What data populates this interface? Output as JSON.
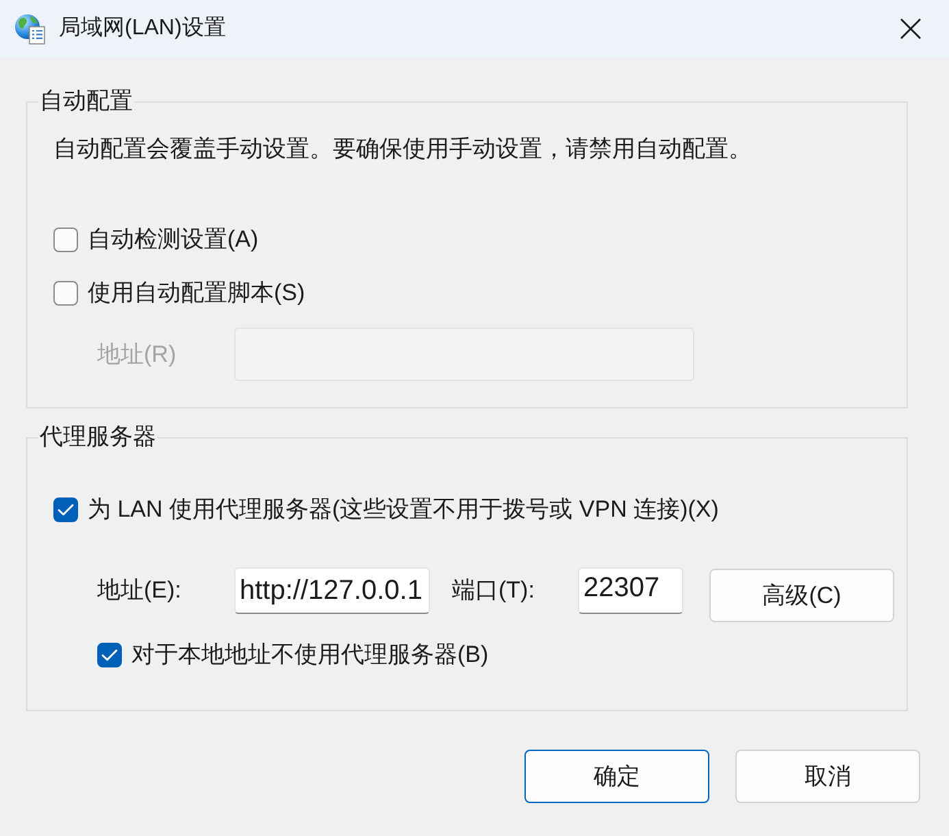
{
  "window": {
    "title": "局域网(LAN)设置"
  },
  "auto_config": {
    "legend": "自动配置",
    "description": "自动配置会覆盖手动设置。要确保使用手动设置，请禁用自动配置。",
    "options": [
      {
        "label": "自动检测设置(A)",
        "checked": false
      },
      {
        "label": "使用自动配置脚本(S)",
        "checked": false
      }
    ],
    "script_address": {
      "label": "地址(R)",
      "disabled": true
    }
  },
  "proxy_server": {
    "legend": "代理服务器",
    "use_proxy": {
      "label": "为 LAN 使用代理服务器(这些设置不用于拨号或 VPN 连接)(X)",
      "checked": true
    },
    "address": {
      "label": "地址(E):",
      "value": "http://127.0.0.1"
    },
    "port": {
      "label": "端口(T):",
      "value": "22307"
    },
    "advanced_button": {
      "label": "高级(C)"
    },
    "bypass_local": {
      "label": "对于本地地址不使用代理服务器(B)",
      "checked": true
    }
  },
  "buttons": [
    {
      "label": "确定",
      "default": true
    },
    {
      "label": "取消",
      "default": false
    }
  ]
}
